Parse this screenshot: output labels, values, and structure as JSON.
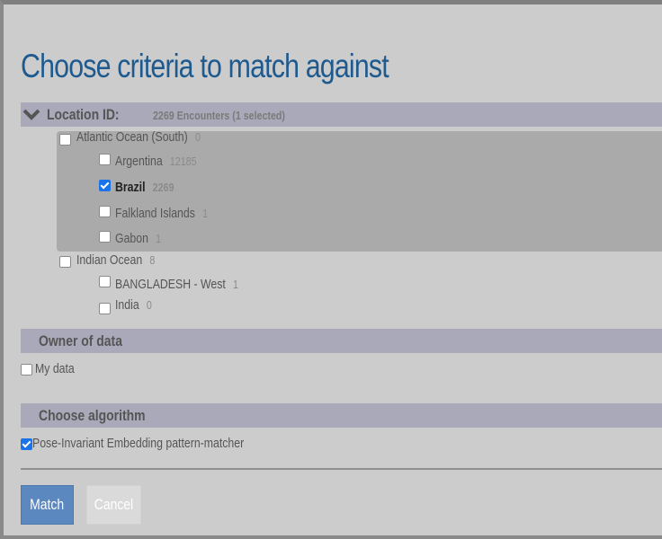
{
  "dialog": {
    "title": "Choose criteria to match against"
  },
  "location": {
    "header_label": "Location ID:",
    "summary": "2269 Encounters (1 selected)",
    "groups": [
      {
        "label": "Atlantic Ocean (South)",
        "count": "0",
        "checked": false,
        "children": [
          {
            "label": "Argentina",
            "count": "12185",
            "checked": false
          },
          {
            "label": "Brazil",
            "count": "2269",
            "checked": true
          },
          {
            "label": "Falkland Islands",
            "count": "1",
            "checked": false
          },
          {
            "label": "Gabon",
            "count": "1",
            "checked": false
          }
        ]
      },
      {
        "label": "Indian Ocean",
        "count": "8",
        "checked": false,
        "children": [
          {
            "label": "BANGLADESH - West",
            "count": "1",
            "checked": false
          },
          {
            "label": "India",
            "count": "0",
            "checked": false
          }
        ]
      }
    ]
  },
  "owner": {
    "header_label": "Owner of data",
    "options": [
      {
        "label": "My data",
        "checked": false
      }
    ]
  },
  "algorithm": {
    "header_label": "Choose algorithm",
    "options": [
      {
        "label": "Pose-Invariant Embedding pattern-matcher",
        "checked": true
      }
    ]
  },
  "actions": {
    "match_label": "Match",
    "cancel_label": "Cancel"
  },
  "colors": {
    "title": "#1f5a8f",
    "section_bar": "#aaa9b9",
    "selected_group": "#aaaaaa",
    "match_button": "#5b88be",
    "checkbox_checked": "#1a73e8"
  },
  "icons": {
    "collapse": "chevron-down-icon"
  }
}
